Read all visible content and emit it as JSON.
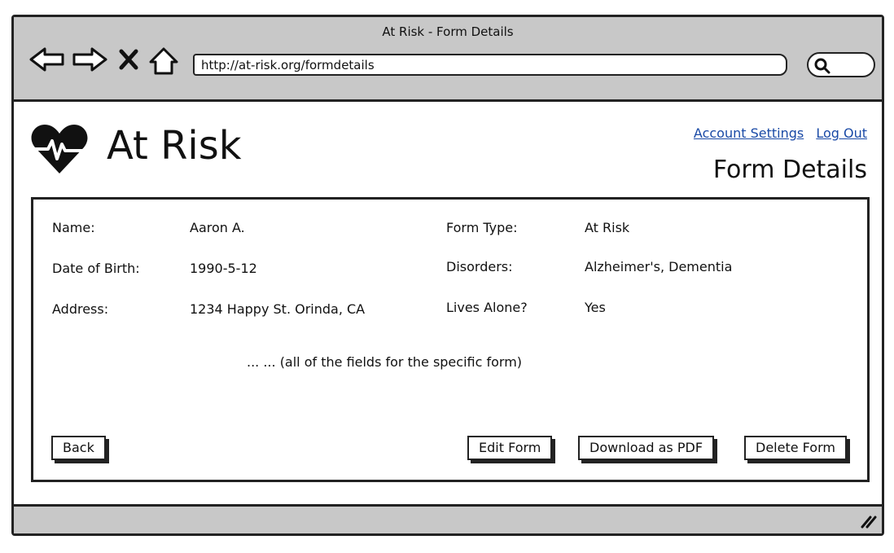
{
  "window": {
    "title": "At Risk - Form Details",
    "url": "http://at-risk.org/formdetails"
  },
  "header": {
    "brand": "At Risk",
    "links": {
      "account_settings": "Account Settings",
      "log_out": "Log Out"
    },
    "page_title": "Form Details"
  },
  "form": {
    "left": [
      {
        "label": "Name:",
        "value": "Aaron A."
      },
      {
        "label": "Date of Birth:",
        "value": "1990-5-12"
      },
      {
        "label": "Address:",
        "value": "1234 Happy St. Orinda, CA"
      }
    ],
    "right": [
      {
        "label": "Form Type:",
        "value": "At Risk"
      },
      {
        "label": "Disorders:",
        "value": "Alzheimer's, Dementia"
      },
      {
        "label": "Lives Alone?",
        "value": "Yes"
      }
    ],
    "note": "... ... (all of the fields for the specific form)"
  },
  "buttons": {
    "back": "Back",
    "edit": "Edit Form",
    "download": "Download as PDF",
    "delete": "Delete Form"
  },
  "colors": {
    "chrome": "#c8c8c8",
    "link": "#1a4aa6",
    "ink": "#111111"
  },
  "icons": [
    "back-arrow-icon",
    "forward-arrow-icon",
    "stop-icon",
    "home-icon",
    "search-icon",
    "heartbeat-logo-icon",
    "resize-grip-icon"
  ]
}
